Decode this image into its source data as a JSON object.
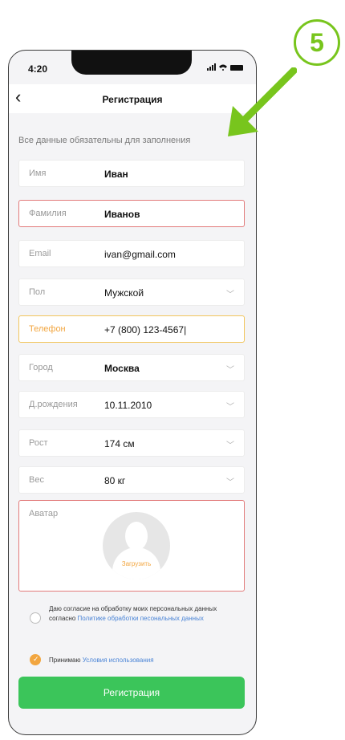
{
  "status": {
    "time": "4:20"
  },
  "nav": {
    "title": "Регистрация"
  },
  "hint": "Все данные обязательны для заполнения",
  "fields": [
    {
      "label": "Имя",
      "value": "Иван"
    },
    {
      "label": "Фамилия",
      "value": "Иванов"
    },
    {
      "label": "Email",
      "value": "ivan@gmail.com"
    },
    {
      "label": "Пол",
      "value": "Мужской"
    },
    {
      "label": "Телефон",
      "value": "+7 (800) 123-4567|"
    },
    {
      "label": "Город",
      "value": "Москва"
    },
    {
      "label": "Д.рождения",
      "value": "10.11.2010"
    },
    {
      "label": "Рост",
      "value": "174 см"
    },
    {
      "label": "Вес",
      "value": "80 кг"
    }
  ],
  "avatar": {
    "label": "Аватар",
    "upload": "Загрузить"
  },
  "consent": {
    "personal_text": "Даю согласие на обработку моих персональных данных согласно",
    "personal_link": "Политике обработки песональных данных",
    "terms_text": "Принимаю",
    "terms_link": "Условия использования"
  },
  "button": {
    "label": "Регистрация"
  },
  "annotation": {
    "number": "5"
  },
  "colors": {
    "accent": "#3bc55a",
    "error": "#e27b7b",
    "focus": "#f2c55b",
    "annotation": "#78c51d"
  }
}
